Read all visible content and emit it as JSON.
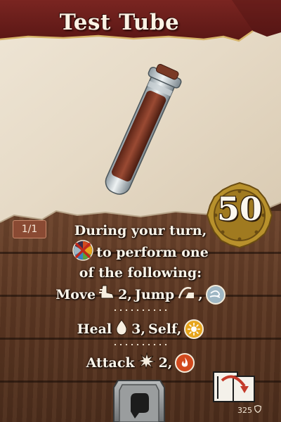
{
  "card": {
    "title": "Test Tube",
    "count": "1/1",
    "cost": "50",
    "ability": {
      "line1": "During your turn,",
      "line2": "to perform one",
      "line3": "of the following:",
      "move": {
        "label": "Move",
        "value": "2,",
        "jump": "Jump",
        "trailing": ","
      },
      "heal": {
        "label": "Heal",
        "value": "3,",
        "target": "Self,"
      },
      "attack": {
        "label": "Attack",
        "value": "2,"
      }
    },
    "item_number": "325",
    "icons": {
      "element_any": "multi-element-wheel-icon",
      "move": "move-boot-icon",
      "jump": "jump-icon",
      "air": "air-element-icon",
      "heal": "heal-drop-icon",
      "light": "light-element-icon",
      "attack": "attack-burst-icon",
      "fire": "fire-element-icon",
      "slot": "hand-slot-icon",
      "usage": "flip-card-icon",
      "item_mark": "shield-mark-icon"
    },
    "colors": {
      "banner": "#6e1f1c",
      "parchment": "#e9dfcf",
      "wood": "#5a3622",
      "coin": "#b8912c",
      "air": "#9fb7c4",
      "light": "#e7a51c",
      "fire": "#d24a1e"
    }
  }
}
